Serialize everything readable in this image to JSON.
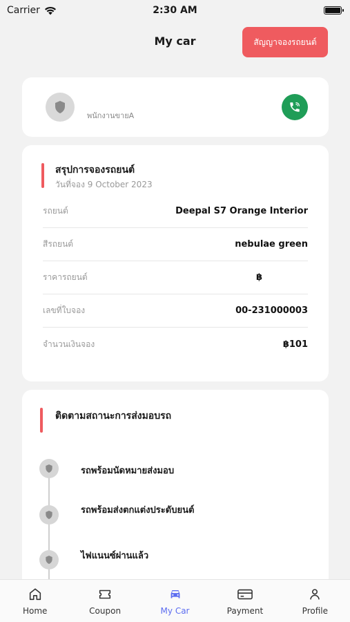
{
  "status_bar": {
    "carrier": "Carrier",
    "time": "2:30 AM"
  },
  "header": {
    "title": "My car",
    "contract_button": "สัญญาจองรถยนต์"
  },
  "salesperson": {
    "name": "พนักงานขายA"
  },
  "summary": {
    "title": "สรุปการจองรถยนต์",
    "date": "วันที่จอง 9 October 2023",
    "rows": [
      {
        "label": "รถยนต์",
        "value": "Deepal S7 Orange Interior"
      },
      {
        "label": "สีรถยนต์",
        "value": "nebulae green"
      },
      {
        "label": "ราคารถยนต์",
        "value": "฿"
      },
      {
        "label": "เลขที่ใบจอง",
        "value": "00-231000003"
      },
      {
        "label": "จำนวนเงินจอง",
        "value": "฿101"
      }
    ]
  },
  "tracking": {
    "title": "ติดตามสถานะการส่งมอบรถ",
    "steps": [
      {
        "label": "รถพร้อมนัดหมายส่งมอบ"
      },
      {
        "label": "รถพร้อมส่งตกแต่งประดับยนต์"
      },
      {
        "label": "ไฟแนนซ์ผ่านแล้ว"
      }
    ]
  },
  "tabs": [
    {
      "label": "Home",
      "icon": "home-icon"
    },
    {
      "label": "Coupon",
      "icon": "coupon-icon"
    },
    {
      "label": "My Car",
      "icon": "car-icon",
      "active": true
    },
    {
      "label": "Payment",
      "icon": "payment-icon"
    },
    {
      "label": "Profile",
      "icon": "profile-icon"
    }
  ],
  "colors": {
    "accent": "#ef5b5f",
    "call": "#1f9d57",
    "active_tab": "#5b6cf0"
  }
}
